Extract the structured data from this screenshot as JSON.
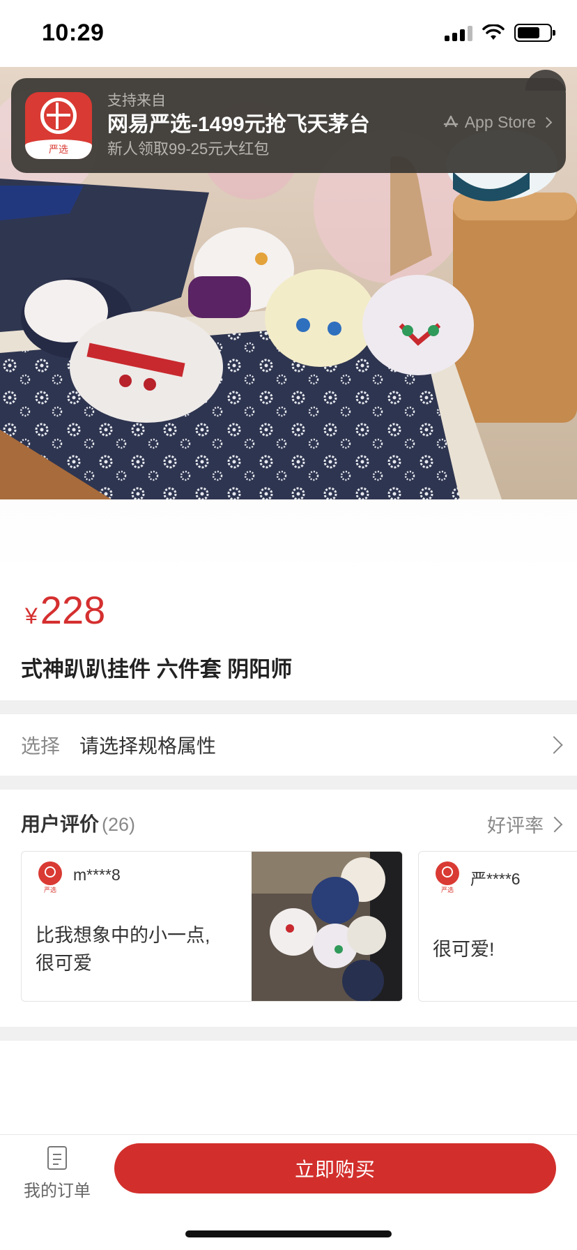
{
  "status_bar": {
    "time": "10:29"
  },
  "banner": {
    "source_label": "支持来自",
    "title": "网易严选-1499元抢飞天茅台",
    "subtitle": "新人领取99-25元大红包",
    "store_label": "App Store",
    "logo_text": "严选"
  },
  "product": {
    "currency": "¥",
    "price": "228",
    "title": "式神趴趴挂件 六件套 阴阳师"
  },
  "spec": {
    "label": "选择",
    "value": "请选择规格属性"
  },
  "reviews": {
    "title": "用户评价",
    "count": "(26)",
    "rate_label": "好评率",
    "items": [
      {
        "user": "m****8",
        "text_line1": "比我想象中的小一点,",
        "text_line2": "很可爱",
        "avatar_tag": "严选"
      },
      {
        "user": "严****6",
        "text_line1": "很可爱!",
        "avatar_tag": "严选"
      }
    ]
  },
  "bottom_bar": {
    "orders_label": "我的订单",
    "buy_label": "立即购买"
  },
  "colors": {
    "accent": "#d22f2c",
    "banner_bg": "#3a3834",
    "divider": "#f0f0f0"
  },
  "icons": [
    "signal-icon",
    "wifi-icon",
    "battery-icon",
    "app-store-icon",
    "chevron-right-icon",
    "orders-icon"
  ]
}
